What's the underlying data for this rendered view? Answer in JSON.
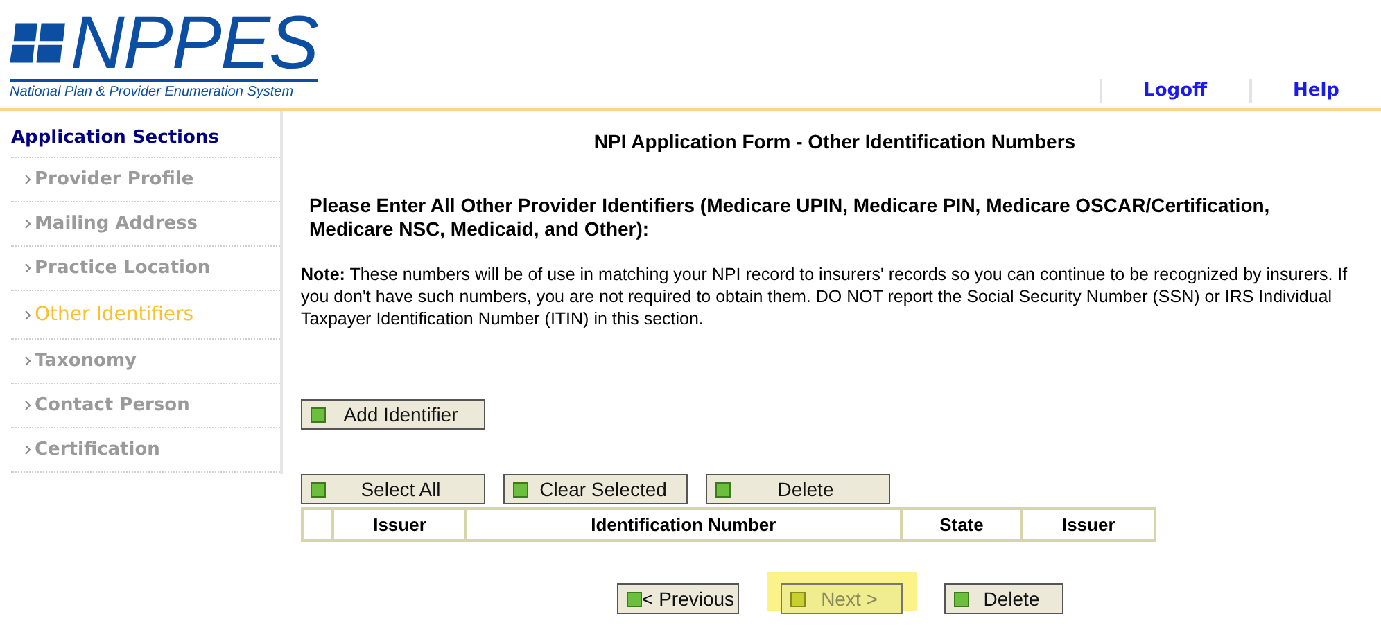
{
  "header": {
    "logo": "NPPES",
    "subtitle": "National Plan & Provider Enumeration System",
    "links": [
      "Logoff",
      "Help"
    ]
  },
  "sidebar": {
    "title": "Application Sections",
    "items": [
      {
        "label": "Provider Profile",
        "selected": false
      },
      {
        "label": "Mailing Address",
        "selected": false
      },
      {
        "label": "Practice Location",
        "selected": false
      },
      {
        "label": "Other Identifiers",
        "selected": true
      },
      {
        "label": "Taxonomy",
        "selected": false
      },
      {
        "label": "Contact Person",
        "selected": false
      },
      {
        "label": "Certification",
        "selected": false
      }
    ]
  },
  "page_title": "NPI Application Form - Other Identification Numbers",
  "instruction": "Please Enter All Other Provider Identifiers (Medicare UPIN, Medicare PIN, Medicare OSCAR/Certification, Medicare NSC, Medicaid, and Other):",
  "note": "**Note:** These numbers will be of use in matching your NPI record to insurers' records so you can continue to be recognized by insurers. If you don't have such numbers, you are not required to obtain them. DO NOT report the Social Security Number (SSN) or IRS Individual Taxpayer Identification Number (ITIN) in this section.",
  "add_button": "Add Identifier",
  "table_buttons": [
    "Select All",
    "Clear Selected",
    "Delete"
  ],
  "table": {
    "columns": [
      "Issuer",
      "Identification Number",
      "State",
      "Issuer"
    ]
  },
  "nav_buttons": [
    {
      "label": "< Previous",
      "highlighted": false,
      "disabled": false
    },
    {
      "label": "Next >",
      "highlighted": true,
      "disabled": true
    },
    {
      "label": "Delete",
      "highlighted": false,
      "disabled": false
    }
  ]
}
